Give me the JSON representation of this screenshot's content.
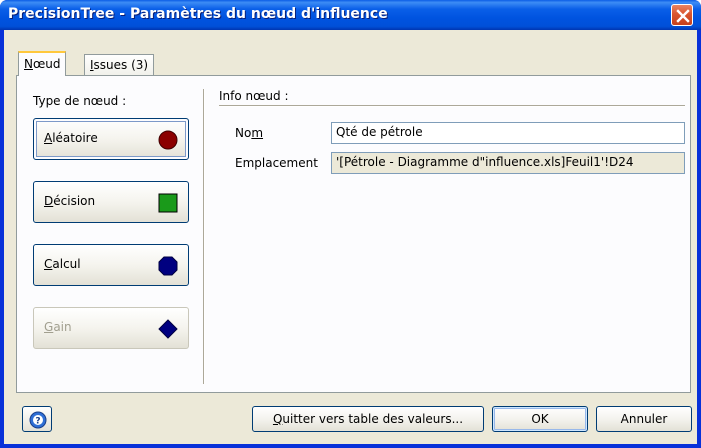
{
  "window": {
    "title": "PrecisionTree - Paramètres du nœud d'influence"
  },
  "tabs": [
    {
      "label_ul": "N",
      "label_rest": "œud",
      "active": true
    },
    {
      "label_ul": "I",
      "label_rest": "ssues (3)",
      "active": false
    }
  ],
  "node_type": {
    "heading": "Type de nœud :",
    "options": [
      {
        "ul": "A",
        "rest": "léatoire",
        "shape": "circle",
        "color": "#8b0000",
        "selected": true,
        "enabled": true
      },
      {
        "ul": "D",
        "rest": "écision",
        "shape": "square",
        "color": "#1a9a1a",
        "selected": false,
        "enabled": true
      },
      {
        "ul": "C",
        "rest": "alcul",
        "shape": "octagon",
        "color": "#000080",
        "selected": false,
        "enabled": true
      },
      {
        "ul": "G",
        "rest": "ain",
        "shape": "diamond",
        "color": "#000080",
        "selected": false,
        "enabled": false
      }
    ]
  },
  "info": {
    "heading": "Info nœud :",
    "name_label_pre": "No",
    "name_label_ul": "m",
    "name_value": "Qté de pétrole",
    "location_label": "Emplacement",
    "location_value": "'[Pétrole - Diagramme d\"influence.xls]Feuil1'!D24"
  },
  "footer": {
    "help_icon": "help-icon",
    "goto_ul": "Q",
    "goto_rest": "uitter vers table des valeurs...",
    "ok_label": "OK",
    "cancel_label": "Annuler"
  },
  "colors": {
    "title_bar": "#0054e3",
    "dialog_bg": "#ece9d8",
    "close_button": "#d9562f"
  }
}
